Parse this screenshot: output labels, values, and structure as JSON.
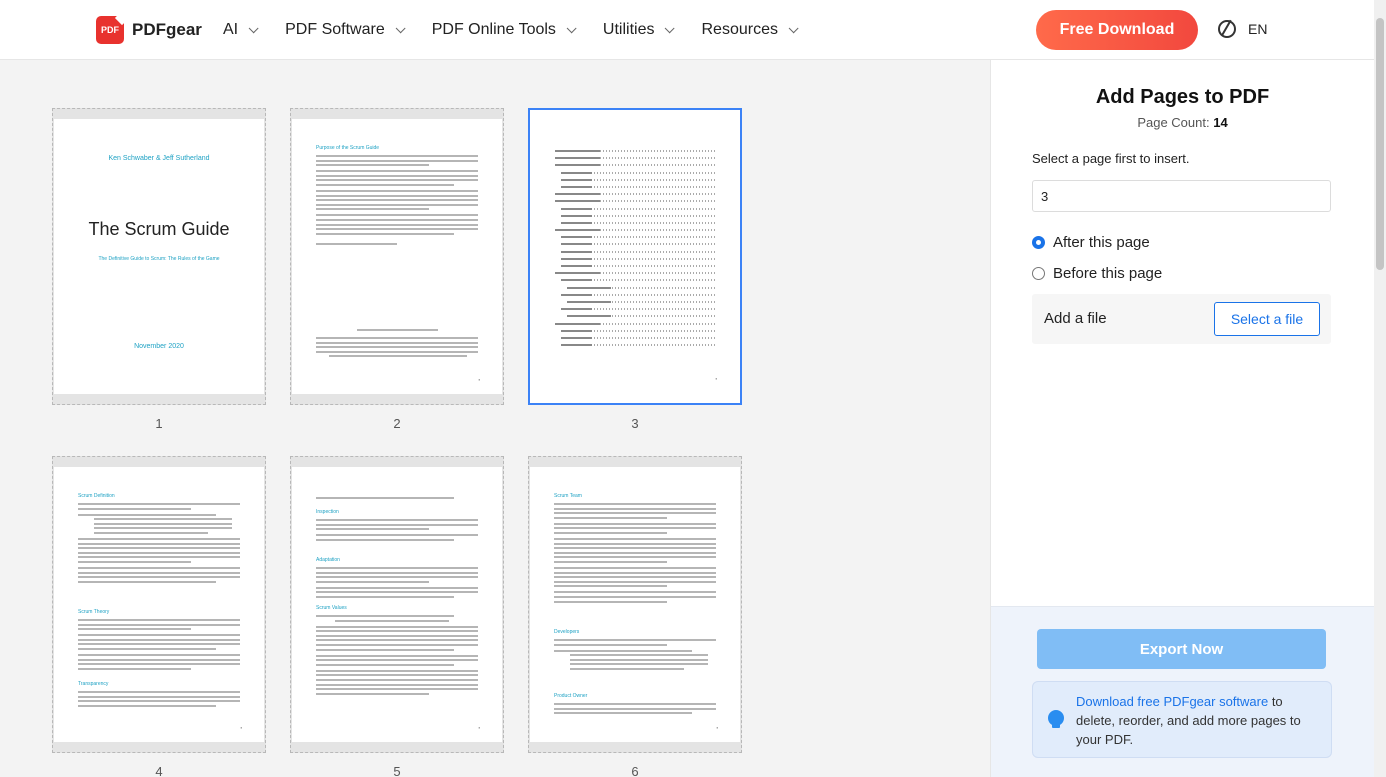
{
  "header": {
    "logo_text": "PDFgear",
    "logo_mark": "PDF",
    "nav": [
      {
        "label": "AI"
      },
      {
        "label": "PDF Software"
      },
      {
        "label": "PDF Online Tools"
      },
      {
        "label": "Utilities"
      },
      {
        "label": "Resources"
      }
    ],
    "download_label": "Free Download",
    "language": "EN"
  },
  "pages": {
    "numbers": [
      "1",
      "2",
      "3",
      "4",
      "5",
      "6"
    ],
    "selected": "3",
    "cover": {
      "author": "Ken Schwaber & Jeff Sutherland",
      "title": "The Scrum Guide",
      "subtitle": "The Definitive Guide to Scrum: The Rules of the Game",
      "date": "November 2020"
    },
    "page2_heading": "Purpose of the Scrum Guide",
    "page4_headings": [
      "Scrum Definition",
      "Scrum Theory",
      "Transparency"
    ],
    "page5_headings": [
      "Inspection",
      "Adaptation",
      "Scrum Values"
    ],
    "page6_headings": [
      "Scrum Team",
      "Developers",
      "Product Owner"
    ]
  },
  "panel": {
    "title": "Add Pages to PDF",
    "page_count_label": "Page Count:",
    "page_count": "14",
    "hint": "Select a page first to insert.",
    "page_input": "3",
    "options": [
      {
        "label": "After this page",
        "selected": true
      },
      {
        "label": "Before this page",
        "selected": false
      }
    ],
    "add_file_label": "Add a file",
    "select_file_label": "Select a file",
    "export_label": "Export Now",
    "promo_link": "Download free PDFgear software",
    "promo_text": " to delete, reorder, and add more pages to your PDF."
  },
  "colors": {
    "accent": "#1a73e8",
    "brand": "#f2483e",
    "export_disabled": "#80bdf5"
  }
}
